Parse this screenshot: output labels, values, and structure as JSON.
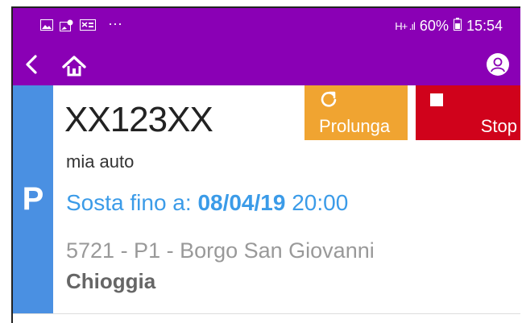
{
  "status_bar": {
    "notification_icons": [
      "image-icon",
      "photo-location-icon",
      "card-icon"
    ],
    "more": "···",
    "signal": "H+ .ıl",
    "battery": "60%",
    "time": "15:54"
  },
  "app_bar": {
    "back_icon": "chevron-left-icon",
    "home_icon": "home-icon",
    "account_icon": "user-icon"
  },
  "parking": {
    "badge": "P",
    "plate": "XX123XX",
    "description": "mia auto",
    "until_label": "Sosta fino a:",
    "until_date": "08/04/19",
    "until_time": "20:00",
    "address": "5721 - P1 - Borgo San Giovanni",
    "city": "Chioggia"
  },
  "actions": {
    "extend_label": "Prolunga",
    "stop_label": "Stop",
    "extend_color": "#f0a431",
    "stop_color": "#d0021b"
  },
  "colors": {
    "primary": "#8a00b5",
    "badge": "#4a90e2",
    "link": "#3b9be8"
  }
}
